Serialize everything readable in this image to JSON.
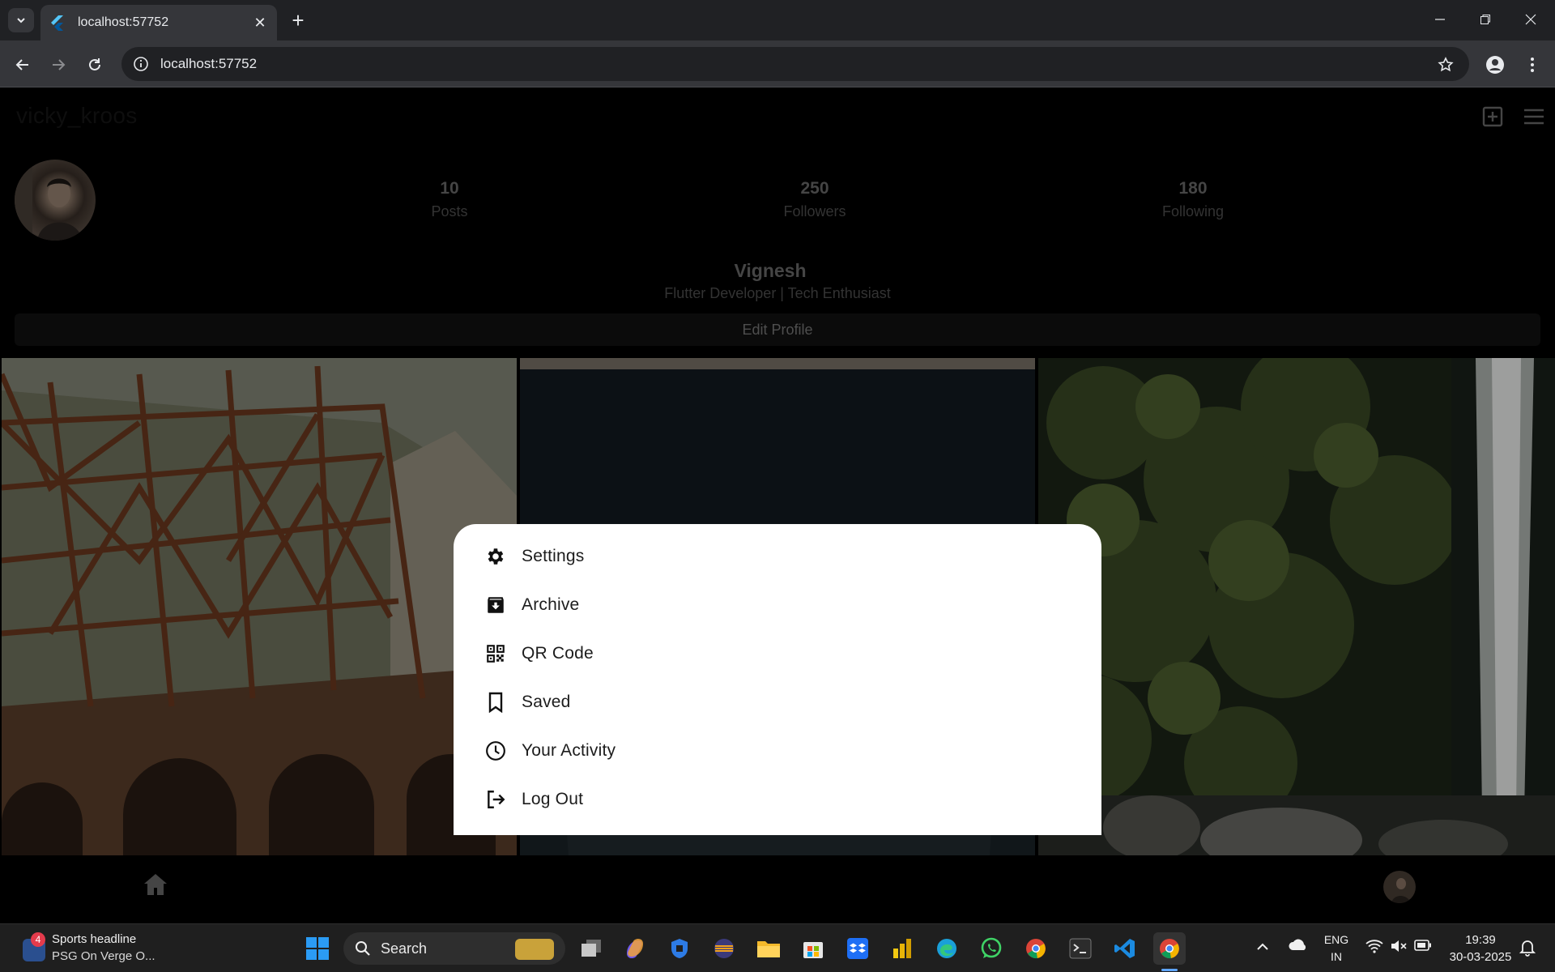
{
  "browser": {
    "tab_title": "localhost:57752",
    "url": "localhost:57752"
  },
  "profile": {
    "username": "vicky_kroos",
    "display_name": "Vignesh",
    "bio": "Flutter Developer | Tech Enthusiast",
    "edit_button": "Edit Profile",
    "stats": [
      {
        "value": "10",
        "label": "Posts"
      },
      {
        "value": "250",
        "label": "Followers"
      },
      {
        "value": "180",
        "label": "Following"
      }
    ]
  },
  "menu": {
    "items": [
      {
        "label": "Settings",
        "icon": "settings-icon"
      },
      {
        "label": "Archive",
        "icon": "archive-icon"
      },
      {
        "label": "QR Code",
        "icon": "qr-code-icon"
      },
      {
        "label": "Saved",
        "icon": "bookmark-icon"
      },
      {
        "label": "Your Activity",
        "icon": "clock-icon"
      },
      {
        "label": "Log Out",
        "icon": "logout-icon"
      }
    ]
  },
  "taskbar": {
    "widget_title": "Sports headline",
    "widget_subtitle": "PSG On Verge O...",
    "widget_badge": "4",
    "search_label": "Search",
    "lang_line1": "ENG",
    "lang_line2": "IN",
    "time": "19:39",
    "date": "30-03-2025"
  }
}
